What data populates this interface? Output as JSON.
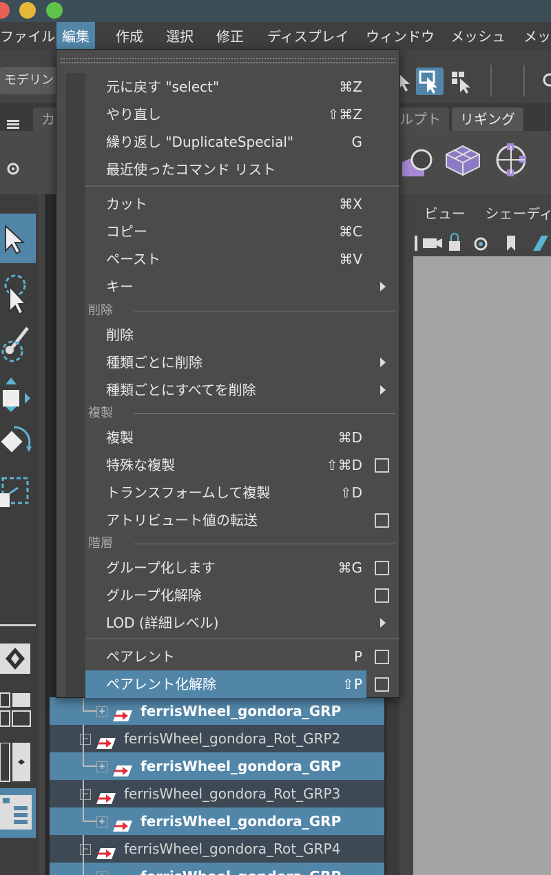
{
  "menubar": {
    "items": [
      "ファイル",
      "編集",
      "作成",
      "選択",
      "修正",
      "ディスプレイ",
      "ウィンドウ",
      "メッシュ",
      "メッ"
    ],
    "active_index": 1
  },
  "toolbar": {
    "mode_label": "モデリン"
  },
  "shelf": {
    "tabs": [
      "カ",
      "ルプト",
      "リギング"
    ],
    "active_tab": "リギング"
  },
  "viewport": {
    "menu_view": "ビュー",
    "menu_shading": "シェーディ"
  },
  "edit_menu": {
    "items": [
      {
        "label": "元に戻す \"select\"",
        "shortcut": "⌘Z"
      },
      {
        "label": "やり直し",
        "shortcut": "⇧⌘Z"
      },
      {
        "label": "繰り返し \"DuplicateSpecial\"",
        "shortcut": "G"
      },
      {
        "label": "最近使ったコマンド リスト",
        "shortcut": ""
      },
      {
        "label": "カット",
        "shortcut": "⌘X"
      },
      {
        "label": "コピー",
        "shortcut": "⌘C"
      },
      {
        "label": "ペースト",
        "shortcut": "⌘V"
      },
      {
        "label": "キー",
        "shortcut": ""
      },
      {
        "label": "削除",
        "shortcut": ""
      },
      {
        "label": "種類ごとに削除",
        "shortcut": ""
      },
      {
        "label": "種類ごとにすべてを削除",
        "shortcut": ""
      },
      {
        "label": "複製",
        "shortcut": "⌘D"
      },
      {
        "label": "特殊な複製",
        "shortcut": "⇧⌘D"
      },
      {
        "label": "トランスフォームして複製",
        "shortcut": "⇧D"
      },
      {
        "label": "アトリビュート値の転送",
        "shortcut": ""
      },
      {
        "label": "グループ化します",
        "shortcut": "⌘G"
      },
      {
        "label": "グループ化解除",
        "shortcut": ""
      },
      {
        "label": "LOD (詳細レベル)",
        "shortcut": ""
      },
      {
        "label": "ペアレント",
        "shortcut": "P"
      },
      {
        "label": "ペアレント化解除",
        "shortcut": "⇧P"
      }
    ],
    "sections": [
      "削除",
      "複製",
      "階層"
    ]
  },
  "outliner": {
    "rows": [
      {
        "label": "ferrisWheel_gondora_GRP",
        "kind": "child"
      },
      {
        "label": "ferrisWheel_gondora_Rot_GRP2",
        "kind": "parent"
      },
      {
        "label": "ferrisWheel_gondora_GRP",
        "kind": "child"
      },
      {
        "label": "ferrisWheel_gondora_Rot_GRP3",
        "kind": "parent"
      },
      {
        "label": "ferrisWheel_gondora_GRP",
        "kind": "child"
      },
      {
        "label": "ferrisWheel_gondora_Rot_GRP4",
        "kind": "parent"
      },
      {
        "label": "ferrisWheel_gondora_GRP",
        "kind": "child"
      }
    ]
  },
  "colors": {
    "accent": "#5286a8",
    "menu_bg": "#4b4b4b",
    "titlebar": "#3c4f58"
  }
}
